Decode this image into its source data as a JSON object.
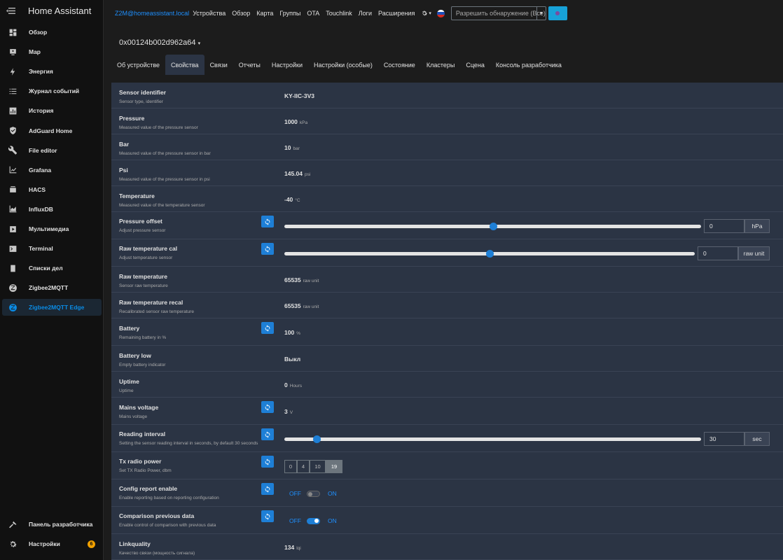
{
  "sidebar": {
    "title": "Home Assistant",
    "items": [
      {
        "label": "Обзор",
        "icon": "dashboard-icon"
      },
      {
        "label": "Map",
        "icon": "map-icon"
      },
      {
        "label": "Энергия",
        "icon": "lightning-icon"
      },
      {
        "label": "Журнал событий",
        "icon": "list-icon"
      },
      {
        "label": "История",
        "icon": "chart-bar-icon"
      },
      {
        "label": "AdGuard Home",
        "icon": "shield-icon"
      },
      {
        "label": "File editor",
        "icon": "wrench-icon"
      },
      {
        "label": "Grafana",
        "icon": "chart-line-icon"
      },
      {
        "label": "HACS",
        "icon": "hacs-icon"
      },
      {
        "label": "InfluxDB",
        "icon": "chart-area-icon"
      },
      {
        "label": "Мультимедиа",
        "icon": "play-box-icon"
      },
      {
        "label": "Terminal",
        "icon": "console-icon"
      },
      {
        "label": "Списки дел",
        "icon": "clipboard-list-icon"
      },
      {
        "label": "Zigbee2MQTT",
        "icon": "zigbee-icon"
      },
      {
        "label": "Zigbee2MQTT Edge",
        "icon": "zigbee-icon",
        "active": true
      }
    ],
    "bottom": [
      {
        "label": "Панель разработчика",
        "icon": "hammer-icon"
      },
      {
        "label": "Настройки",
        "icon": "cog-icon",
        "badge": "6"
      }
    ]
  },
  "topnav": {
    "brand": "Z2M@homeassistant.local",
    "links": [
      "Устройства",
      "Обзор",
      "Карта",
      "Группы",
      "OTA",
      "Touchlink",
      "Логи",
      "Расширения"
    ],
    "permit_label": "Разрешить обнаружение (Все)"
  },
  "device": {
    "id": "0x00124b002d962a64",
    "tabs": [
      "Об устройстве",
      "Свойства",
      "Связи",
      "Отчеты",
      "Настройки",
      "Настройки (особые)",
      "Состояние",
      "Кластеры",
      "Сцена",
      "Консоль разработчика"
    ],
    "active_tab": 1
  },
  "rows": [
    {
      "title": "Sensor identifier",
      "sub": "Sensor type, identifier",
      "kind": "value",
      "value": "KY-IIC-3V3",
      "unit": ""
    },
    {
      "title": "Pressure",
      "sub": "Measured value of the pressure sensor",
      "kind": "value",
      "value": "1000",
      "unit": "kPa"
    },
    {
      "title": "Bar",
      "sub": "Measured value of the pressure sensor in bar",
      "kind": "value",
      "value": "10",
      "unit": "bar"
    },
    {
      "title": "Psi",
      "sub": "Measured value of the pressure sensor in psi",
      "kind": "value",
      "value": "145.04",
      "unit": "psi"
    },
    {
      "title": "Temperature",
      "sub": "Measured value of the temperature sensor",
      "kind": "value",
      "value": "-40",
      "unit": "°C"
    },
    {
      "title": "Pressure offset",
      "sub": "Adjust pressure sensor",
      "kind": "slider",
      "refresh": true,
      "value": "0",
      "unit": "hPa",
      "position": 0.5
    },
    {
      "title": "Raw temperature cal",
      "sub": "Adjust temperature sensor",
      "kind": "slider",
      "refresh": true,
      "value": "0",
      "unit": "raw unit",
      "position": 0.5
    },
    {
      "title": "Raw temperature",
      "sub": "Sensor raw temperature",
      "kind": "value",
      "value": "65535",
      "unit": "raw unit"
    },
    {
      "title": "Raw temperature recal",
      "sub": "Recalibrated sensor raw temperature",
      "kind": "value",
      "value": "65535",
      "unit": "raw unit"
    },
    {
      "title": "Battery",
      "sub": "Remaining battery in %",
      "kind": "value",
      "refresh": true,
      "value": "100",
      "unit": "%"
    },
    {
      "title": "Battery low",
      "sub": "Empty battery indicator",
      "kind": "value",
      "value": "Выкл",
      "unit": ""
    },
    {
      "title": "Uptime",
      "sub": "Uptime",
      "kind": "value",
      "value": "0",
      "unit": "Hours"
    },
    {
      "title": "Mains voltage",
      "sub": "Mains voltage",
      "kind": "value",
      "refresh": true,
      "value": "3",
      "unit": "V"
    },
    {
      "title": "Reading interval",
      "sub": "Setting the sensor reading interval in seconds, by default 30 seconds",
      "kind": "slider",
      "refresh": true,
      "value": "30",
      "unit": "sec",
      "position": 0.077
    },
    {
      "title": "Tx radio power",
      "sub": "Set TX Radio Power, dbm",
      "kind": "buttons",
      "refresh": true,
      "options": [
        "0",
        "4",
        "10",
        "19"
      ],
      "selected": 3
    },
    {
      "title": "Config report enable",
      "sub": "Enable reporting based on reporting configuration",
      "kind": "toggle",
      "refresh": true,
      "off": "OFF",
      "on": "ON",
      "state": false
    },
    {
      "title": "Comparison previous data",
      "sub": "Enable control of comparison with previous data",
      "kind": "toggle",
      "refresh": true,
      "off": "OFF",
      "on": "ON",
      "state": true
    },
    {
      "title": "Linkquality",
      "sub": "Качество связи (мощность сигнала)",
      "kind": "value",
      "value": "134",
      "unit": "lqi"
    }
  ],
  "colors": {
    "accent": "#1e7fd6",
    "link": "#1e90ff",
    "panel": "#2b3444"
  }
}
